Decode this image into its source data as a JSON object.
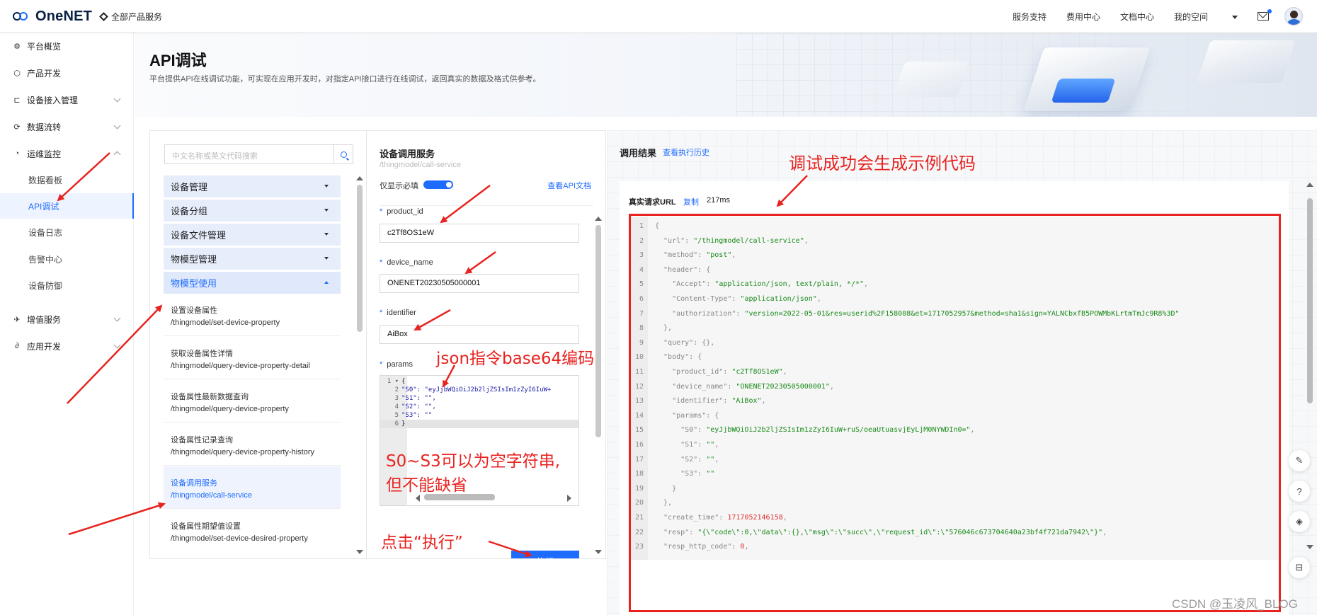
{
  "topbar": {
    "logo": "OneNET",
    "all_products": "全部产品服务",
    "nav": [
      "服务支持",
      "费用中心",
      "文档中心",
      "我的空间"
    ]
  },
  "sidebar": {
    "items": [
      {
        "label": "平台概览",
        "icon": "overview-icon"
      },
      {
        "label": "产品开发",
        "icon": "product-icon"
      },
      {
        "label": "设备接入管理",
        "icon": "device-access-icon"
      },
      {
        "label": "数据流转",
        "icon": "data-flow-icon"
      },
      {
        "label": "运维监控",
        "icon": "monitor-icon"
      }
    ],
    "sub_items": [
      "数据看板",
      "API调试",
      "设备日志",
      "告警中心",
      "设备防御"
    ],
    "items_bottom": [
      {
        "label": "增值服务",
        "icon": "value-added-icon"
      },
      {
        "label": "应用开发",
        "icon": "app-dev-icon"
      }
    ]
  },
  "page": {
    "title": "API调试",
    "description": "平台提供API在线调试功能，可实现在应用开发时，对指定API接口进行在线调试，返回真实的数据及格式供参考。"
  },
  "api_list": {
    "search_placeholder": "中文名称或英文代码搜索",
    "groups": [
      "设备管理",
      "设备分组",
      "设备文件管理",
      "物模型管理",
      "物模型使用"
    ],
    "items": [
      {
        "name": "设置设备属性",
        "path": "/thingmodel/set-device-property"
      },
      {
        "name": "获取设备属性详情",
        "path": "/thingmodel/query-device-property-detail"
      },
      {
        "name": "设备属性最新数据查询",
        "path": "/thingmodel/query-device-property"
      },
      {
        "name": "设备属性记录查询",
        "path": "/thingmodel/query-device-property-history"
      },
      {
        "name": "设备调用服务",
        "path": "/thingmodel/call-service"
      },
      {
        "name": "设备属性期望值设置",
        "path": "/thingmodel/set-device-desired-property"
      }
    ]
  },
  "service": {
    "title": "设备调用服务",
    "path": "/thingmodel/call-service",
    "required_only": "仅显示必填",
    "doc_link": "查看API文档",
    "fields": [
      {
        "label": "product_id",
        "value": "c2Tf8OS1eW"
      },
      {
        "label": "device_name",
        "value": "ONENET20230505000001"
      },
      {
        "label": "identifier",
        "value": "AiBox"
      }
    ],
    "params_label": "params",
    "params_code": [
      "{",
      "\"S0\": \"eyJjbWQiOiJ2b2ljZSIsIm1zZyI6IuW+",
      "\"S1\": \"\",",
      "\"S2\": \"\",",
      "\"S3\": \"\"",
      "}"
    ],
    "execute": "执行"
  },
  "result": {
    "title": "调用结果",
    "history_link": "查看执行历史",
    "url_label": "真实请求URL",
    "copy": "复制",
    "time": "217ms",
    "lines": [
      "{",
      "  \"url\": \"/thingmodel/call-service\",",
      "  \"method\": \"post\",",
      "  \"header\": {",
      "    \"Accept\": \"application/json, text/plain, */*\",",
      "    \"Content-Type\": \"application/json\",",
      "    \"authorization\": \"version=2022-05-01&res=userid%2F158008&et=1717052957&method=sha1&sign=YALNCbxfB5POWMbKLrtmTmJc9R8%3D\"",
      "  },",
      "  \"query\": {},",
      "  \"body\": {",
      "    \"product_id\": \"c2Tf8OS1eW\",",
      "    \"device_name\": \"ONENET20230505000001\",",
      "    \"identifier\": \"AiBox\",",
      "    \"params\": {",
      "      \"S0\": \"eyJjbWQiOiJ2b2ljZSIsIm1zZyI6IuW+ruS/oeaUtuasvjEyLjM0NYWDIn0=\",",
      "      \"S1\": \"\",",
      "      \"S2\": \"\",",
      "      \"S3\": \"\"",
      "    }",
      "  },",
      "  \"create_time\": 1717052146158,",
      "  \"resp\": \"{\\\"code\\\":0,\\\"data\\\":{},\\\"msg\\\":\\\"succ\\\",\\\"request_id\\\":\\\"576046c673704640a23bf4f721da7942\\\"}\",",
      "  \"resp_http_code\": 0,"
    ]
  },
  "annotations": {
    "success_note": "调试成功会生成示例代码",
    "base64_note": "json指令base64编码",
    "empty_note_1": "S0~S3可以为空字符串,",
    "empty_note_2": "但不能缺省",
    "click_note": "点击“执行”"
  },
  "watermark": "CSDN @玉凌风_BLOG",
  "colors": {
    "accent": "#1e6bff",
    "annotation": "#e8231f"
  }
}
